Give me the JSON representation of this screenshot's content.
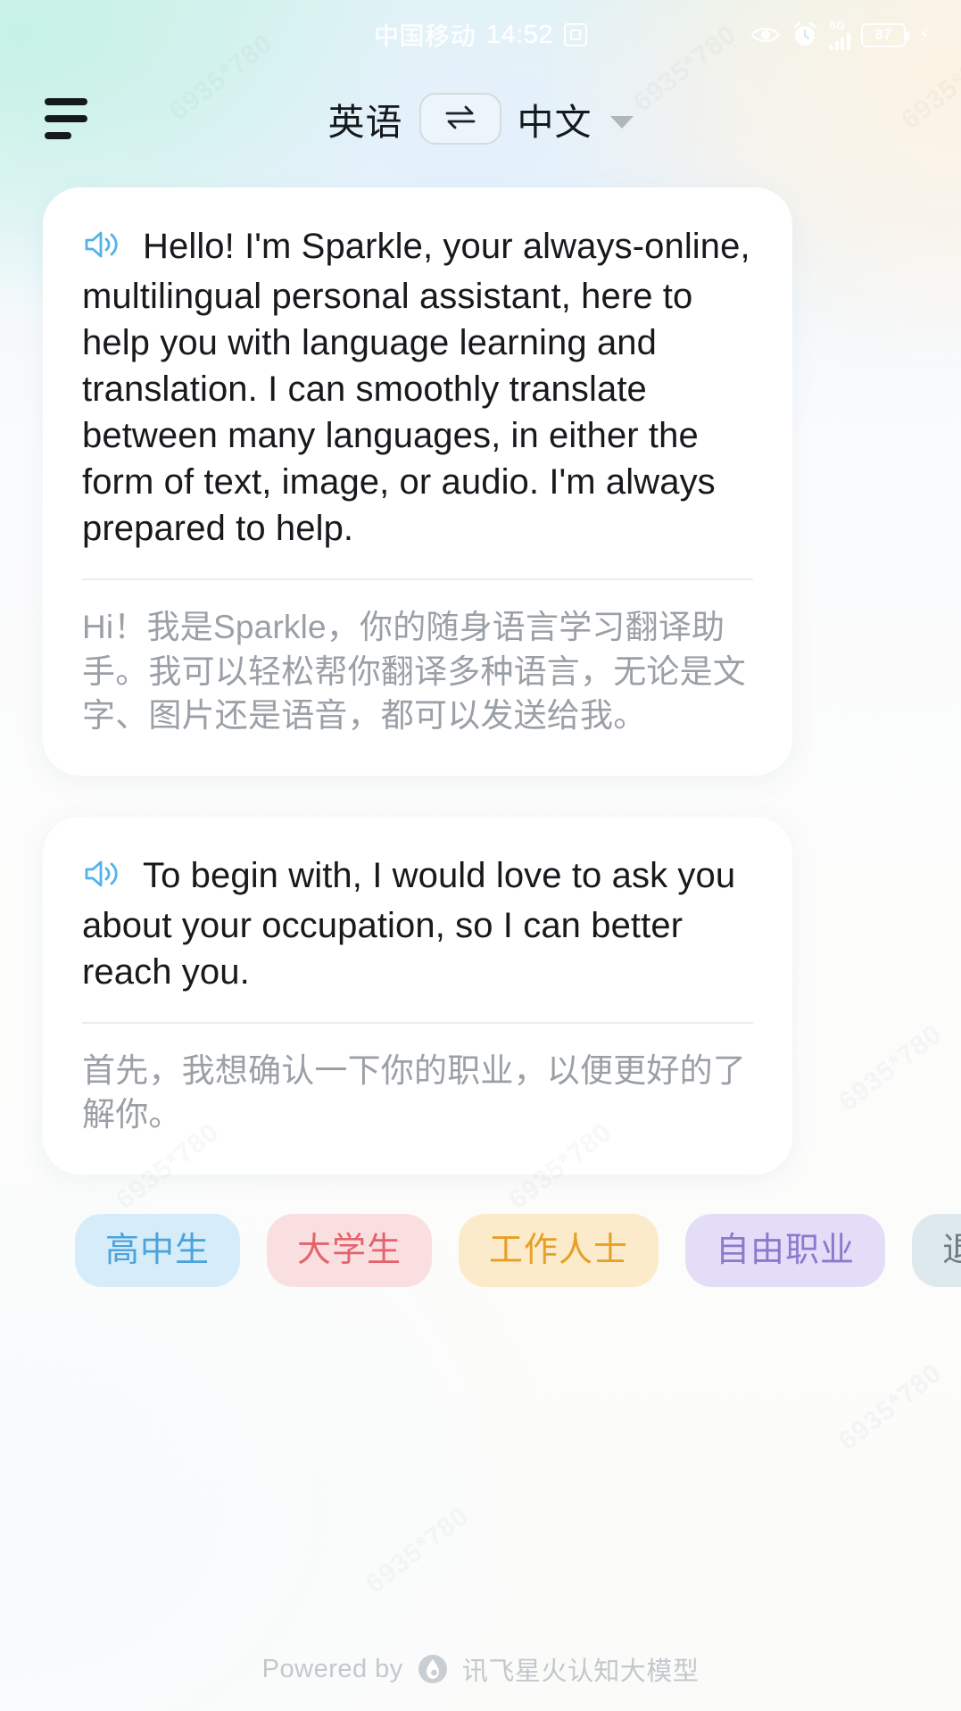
{
  "statusbar": {
    "carrier": "中国移动",
    "time": "14:52",
    "sim_icon": "sim-card-icon",
    "eye_icon": "eye-care-icon",
    "alarm_icon": "alarm-clock-icon",
    "network_label": "5G",
    "signal_icon": "signal-bars-icon",
    "battery_level": "87",
    "charging_icon": "charging-bolt-icon"
  },
  "header": {
    "menu_icon": "hamburger-menu-icon",
    "source_language": "英语",
    "swap_icon": "swap-arrows-icon",
    "target_language": "中文",
    "dropdown_icon": "chevron-down-icon"
  },
  "messages": [
    {
      "speaker_icon": "speaker-volume-icon",
      "primary": "Hello! I'm Sparkle, your always-online, multilingual personal assistant, here to help you with language learning and translation. I can smoothly translate between many languages, in either the form of text, image, or audio. I'm always prepared to help.",
      "secondary": "Hi！我是Sparkle，你的随身语言学习翻译助手。我可以轻松帮你翻译多种语言，无论是文字、图片还是语音，都可以发送给我。"
    },
    {
      "speaker_icon": "speaker-volume-icon",
      "primary": "To begin with, I would love to ask you about your occupation, so I can better reach you.",
      "secondary": "首先，我想确认一下你的职业，以便更好的了解你。"
    }
  ],
  "chips": [
    {
      "label": "高中生",
      "bg": "#d6ecf9",
      "fg": "#4aa3dc"
    },
    {
      "label": "大学生",
      "bg": "#fadfe0",
      "fg": "#e4636c"
    },
    {
      "label": "工作人士",
      "bg": "#fcebca",
      "fg": "#e79f26"
    },
    {
      "label": "自由职业",
      "bg": "#e4ddf7",
      "fg": "#8c79cf"
    },
    {
      "label": "退休",
      "bg": "#dde9ec",
      "fg": "#6f7c82"
    }
  ],
  "footer": {
    "powered_by": "Powered by",
    "brand_icon": "spark-flame-icon",
    "brand_name": "讯飞星火认知大模型"
  },
  "colors": {
    "speaker_blue": "#4fb3e8",
    "text_primary": "#17191c",
    "text_secondary": "#9aa0a6",
    "bubble_bg": "#ffffff"
  }
}
